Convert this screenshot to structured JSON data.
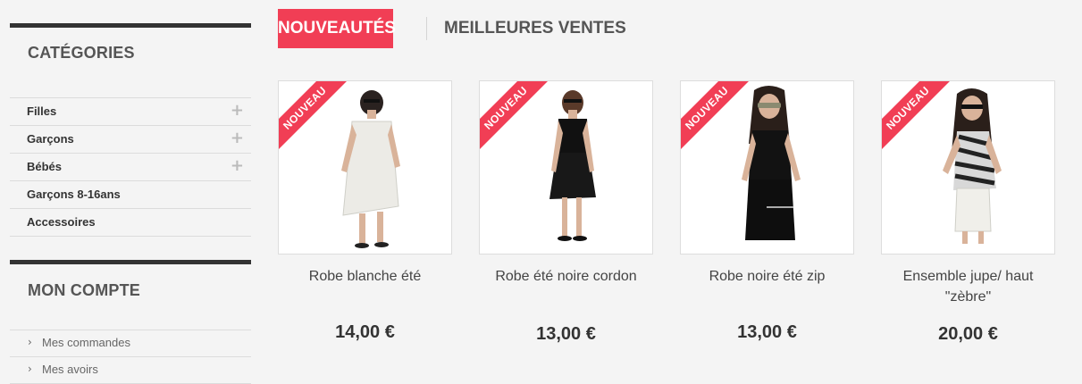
{
  "sidebar": {
    "categories": {
      "title": "CATÉGORIES",
      "items": [
        {
          "label": "Filles",
          "expandable": true
        },
        {
          "label": "Garçons",
          "expandable": true
        },
        {
          "label": "Bébés",
          "expandable": true
        },
        {
          "label": "Garçons 8-16ans",
          "expandable": false
        },
        {
          "label": "Accessoires",
          "expandable": false
        }
      ]
    },
    "account": {
      "title": "MON COMPTE",
      "items": [
        {
          "label": "Mes commandes"
        },
        {
          "label": "Mes avoirs"
        }
      ]
    }
  },
  "tabs": {
    "active": "NOUVEAUTÉS",
    "inactive": "MEILLEURES VENTES"
  },
  "products": [
    {
      "badge": "NOUVEAU",
      "name": "Robe blanche été",
      "price": "14,00 €"
    },
    {
      "badge": "NOUVEAU",
      "name": "Robe été noire cordon",
      "price": "13,00 €"
    },
    {
      "badge": "NOUVEAU",
      "name": "Robe noire été zip",
      "price": "13,00 €"
    },
    {
      "badge": "NOUVEAU",
      "name": "Ensemble jupe/ haut \"zèbre\"",
      "price": "20,00 €"
    }
  ],
  "colors": {
    "accent": "#f13e55",
    "sidebar_bar": "#333333",
    "background": "#f4f4f4"
  },
  "icons": {
    "expand": "plus-icon",
    "bullet": "chevron-right-icon"
  }
}
